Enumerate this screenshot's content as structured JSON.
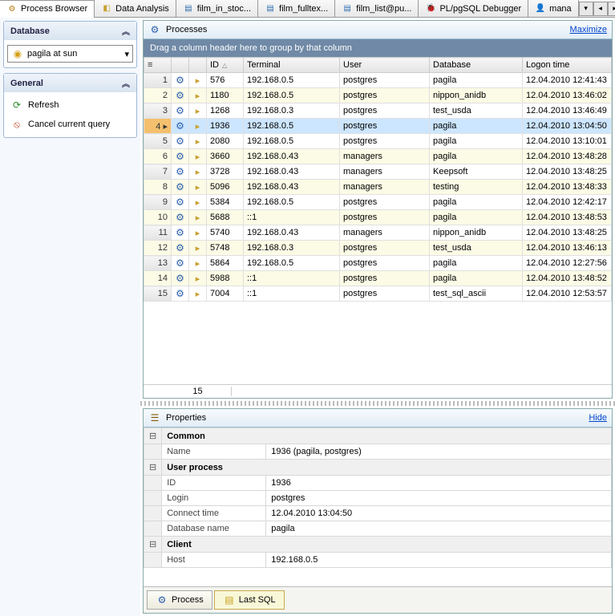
{
  "tabs": [
    {
      "label": "Process Browser",
      "active": true
    },
    {
      "label": "Data Analysis"
    },
    {
      "label": "film_in_stoc..."
    },
    {
      "label": "film_fulltex..."
    },
    {
      "label": "film_list@pu..."
    },
    {
      "label": "PL/pgSQL Debugger"
    },
    {
      "label": "mana"
    }
  ],
  "sidebar": {
    "database": {
      "title": "Database",
      "value": "pagila at sun"
    },
    "general": {
      "title": "General",
      "refresh": "Refresh",
      "cancel": "Cancel current query"
    }
  },
  "processes": {
    "title": "Processes",
    "maximize": "Maximize",
    "group_hint": "Drag a column header here to group by that column",
    "columns": [
      "ID",
      "Terminal",
      "User",
      "Database",
      "Logon time"
    ],
    "rows": [
      {
        "n": 1,
        "id": "576",
        "t": "192.168.0.5",
        "u": "postgres",
        "d": "pagila",
        "l": "12.04.2010 12:41:43"
      },
      {
        "n": 2,
        "id": "1180",
        "t": "192.168.0.5",
        "u": "postgres",
        "d": "nippon_anidb",
        "l": "12.04.2010 13:46:02"
      },
      {
        "n": 3,
        "id": "1268",
        "t": "192.168.0.3",
        "u": "postgres",
        "d": "test_usda",
        "l": "12.04.2010 13:46:49"
      },
      {
        "n": 4,
        "id": "1936",
        "t": "192.168.0.5",
        "u": "postgres",
        "d": "pagila",
        "l": "12.04.2010 13:04:50",
        "sel": true
      },
      {
        "n": 5,
        "id": "2080",
        "t": "192.168.0.5",
        "u": "postgres",
        "d": "pagila",
        "l": "12.04.2010 13:10:01"
      },
      {
        "n": 6,
        "id": "3660",
        "t": "192.168.0.43",
        "u": "managers",
        "d": "pagila",
        "l": "12.04.2010 13:48:28"
      },
      {
        "n": 7,
        "id": "3728",
        "t": "192.168.0.43",
        "u": "managers",
        "d": "Keepsoft",
        "l": "12.04.2010 13:48:25"
      },
      {
        "n": 8,
        "id": "5096",
        "t": "192.168.0.43",
        "u": "managers",
        "d": "testing",
        "l": "12.04.2010 13:48:33"
      },
      {
        "n": 9,
        "id": "5384",
        "t": "192.168.0.5",
        "u": "postgres",
        "d": "pagila",
        "l": "12.04.2010 12:42:17"
      },
      {
        "n": 10,
        "id": "5688",
        "t": "::1",
        "u": "postgres",
        "d": "pagila",
        "l": "12.04.2010 13:48:53"
      },
      {
        "n": 11,
        "id": "5740",
        "t": "192.168.0.43",
        "u": "managers",
        "d": "nippon_anidb",
        "l": "12.04.2010 13:48:25"
      },
      {
        "n": 12,
        "id": "5748",
        "t": "192.168.0.3",
        "u": "postgres",
        "d": "test_usda",
        "l": "12.04.2010 13:46:13"
      },
      {
        "n": 13,
        "id": "5864",
        "t": "192.168.0.5",
        "u": "postgres",
        "d": "pagila",
        "l": "12.04.2010 12:27:56"
      },
      {
        "n": 14,
        "id": "5988",
        "t": "::1",
        "u": "postgres",
        "d": "pagila",
        "l": "12.04.2010 13:48:52"
      },
      {
        "n": 15,
        "id": "7004",
        "t": "::1",
        "u": "postgres",
        "d": "test_sql_ascii",
        "l": "12.04.2010 12:53:57"
      }
    ],
    "count": "15"
  },
  "properties": {
    "title": "Properties",
    "hide": "Hide",
    "groups": [
      {
        "name": "Common",
        "rows": [
          {
            "k": "Name",
            "v": "1936 (pagila, postgres)"
          }
        ]
      },
      {
        "name": "User process",
        "rows": [
          {
            "k": "ID",
            "v": "1936"
          },
          {
            "k": "Login",
            "v": "postgres"
          },
          {
            "k": "Connect time",
            "v": "12.04.2010 13:04:50"
          },
          {
            "k": "Database name",
            "v": "pagila"
          }
        ]
      },
      {
        "name": "Client",
        "rows": [
          {
            "k": "Host",
            "v": "192.168.0.5"
          }
        ]
      }
    ],
    "tabs": {
      "process": "Process",
      "last_sql": "Last SQL"
    }
  }
}
